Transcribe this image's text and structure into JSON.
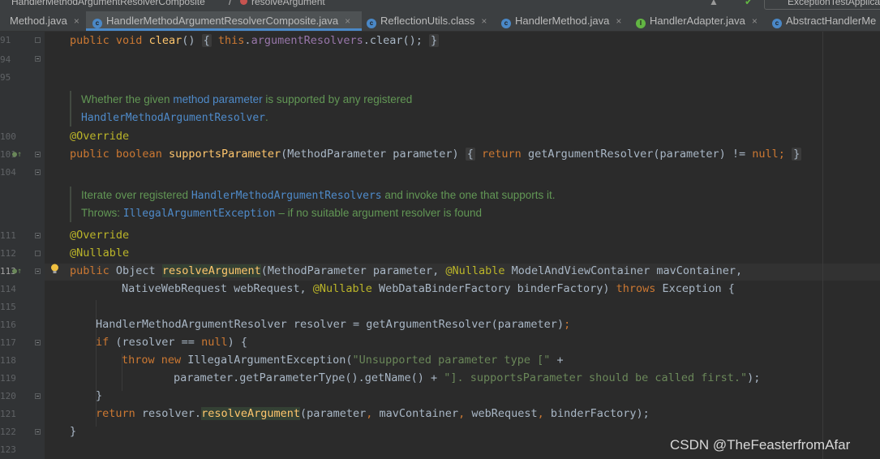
{
  "topbar": {
    "crumb1": "HandlerMethodArgumentResolverComposite",
    "separator": "/",
    "crumb2": "resolveArgument",
    "run_config": "ExceptionTestApplication"
  },
  "tabs": [
    {
      "label": "Method.java",
      "active": false,
      "icon": "class-icon",
      "color": "#4a88c7"
    },
    {
      "label": "HandlerMethodArgumentResolverComposite.java",
      "active": true,
      "icon": "class-icon",
      "color": "#4a88c7"
    },
    {
      "label": "ReflectionUtils.class",
      "active": false,
      "icon": "class-icon",
      "color": "#4a88c7"
    },
    {
      "label": "HandlerMethod.java",
      "active": false,
      "icon": "class-icon",
      "color": "#4a88c7"
    },
    {
      "label": "HandlerAdapter.java",
      "active": false,
      "icon": "interface-icon",
      "color": "#62b543"
    },
    {
      "label": "AbstractHandlerMe",
      "active": false,
      "icon": "class-icon",
      "color": "#4a88c7"
    }
  ],
  "close_glyph": "×",
  "lines": {
    "n91": "91",
    "n94": "94",
    "n95": "95",
    "n100": "100",
    "n101": "101",
    "n104": "104",
    "n111": "111",
    "n112": "112",
    "n113": "113",
    "n114": "114",
    "n115": "115",
    "n116": "116",
    "n117": "117",
    "n118": "118",
    "n119": "119",
    "n120": "120",
    "n121": "121",
    "n122": "122",
    "n123": "123"
  },
  "code": {
    "l1_public": "public",
    "l1_void": "void",
    "l1_clear": "clear",
    "l1_paren": "()",
    "l1_this": "this",
    "l1_field": "argumentResolvers",
    "l1_tail": ".clear();",
    "doc1_a": "Whether the given ",
    "doc1_link": "method parameter",
    "doc1_b": " is supported by any registered",
    "doc1_class": "HandlerMethodArgumentResolver",
    "override1": "@Override",
    "l2_public": "public",
    "l2_boolean": "boolean",
    "l2_method": "supportsParameter",
    "l2_params": "(MethodParameter parameter)",
    "l2_return": "return",
    "l2_body": "getArgumentResolver(parameter) != ",
    "l2_null": "null",
    "doc2_a": "Iterate over registered ",
    "doc2_class": "HandlerMethodArgumentResolvers",
    "doc2_b": " and invoke the one that supports it.",
    "doc2_throws": "Throws: ",
    "doc2_exc": "IllegalArgumentException",
    "doc2_c": " – if no suitable argument resolver is found",
    "override2": "@Override",
    "nullable": "@Nullable",
    "l3_public": "public",
    "l3_type": "Object ",
    "l3_method": "resolveArgument",
    "l3_p1": "(MethodParameter parameter, ",
    "l3_ann1": "@Nullable",
    "l3_p2": " ModelAndViewContainer mavContainer,",
    "l4_p1": "NativeWebRequest webRequest, ",
    "l4_ann": "@Nullable",
    "l4_p2": " WebDataBinderFactory binderFactory) ",
    "l4_throws": "throws",
    "l4_tail": " Exception {",
    "l5": "HandlerMethodArgumentResolver resolver = getArgumentResolver(parameter)",
    "l6_if": "if",
    "l6_a": " (resolver == ",
    "l6_null": "null",
    "l6_b": ") {",
    "l7_throw": "throw",
    "l7_new": "new",
    "l7_cls": " IllegalArgumentException(",
    "l7_str": "\"Unsupported parameter type [\"",
    "l7_plus": " +",
    "l8_a": "parameter.getParameterType().getName() + ",
    "l8_str": "\"]. supportsParameter should be called first.\"",
    "l8_b": ");",
    "l9": "}",
    "l10_return": "return",
    "l10_a": " resolver.",
    "l10_method": "resolveArgument",
    "l10_b": "(parameter",
    "l10_c": " mavContainer",
    "l10_d": " webRequest",
    "l10_e": " binderFactory);",
    "l11": "}",
    "semi": ";",
    "comma": ",",
    "lbrace": "{",
    "rbrace": "}"
  },
  "watermark": "CSDN @TheFeasterfromAfar"
}
